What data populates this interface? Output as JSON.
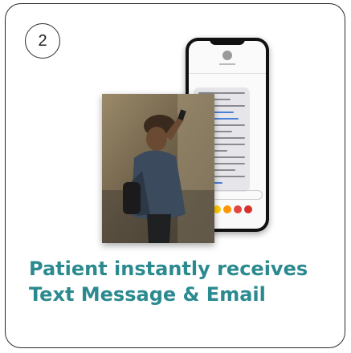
{
  "card": {
    "step_number": "2",
    "caption": "Patient instantly receives Text Message & Email"
  },
  "colors": {
    "caption": "#2b8a8f",
    "border": "#2b2b2b"
  },
  "icons": [
    "woman-using-phone-photo",
    "smartphone-sms-mockup"
  ]
}
